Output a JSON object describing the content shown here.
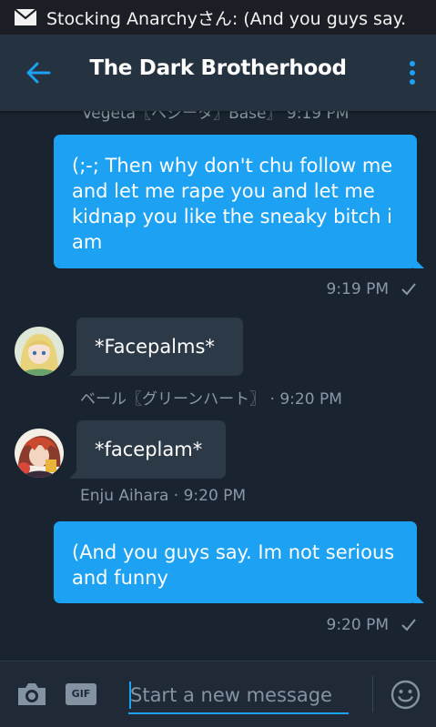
{
  "status_bar": {
    "notification_text": "Stocking Anarchyさん: (And you guys say.",
    "icon": "mail-icon"
  },
  "header": {
    "title": "The Dark Brotherhood",
    "back_icon": "back-arrow-icon",
    "menu_icon": "overflow-menu-icon"
  },
  "chat": {
    "cut_off_meta": "Vegeta〖ベジータ〗Base〗 9:19 PM",
    "messages": [
      {
        "direction": "outgoing",
        "text": "(;-; Then why don't chu follow me and let me rape you and let me kidnap you like the sneaky bitch i am",
        "meta": "9:19 PM"
      },
      {
        "direction": "incoming",
        "text": "*Facepalms*",
        "meta": "ベール〖グリーンハート〗 · 9:20 PM"
      },
      {
        "direction": "incoming",
        "text": "*faceplam*",
        "meta": "Enju Aihara · 9:20 PM"
      },
      {
        "direction": "outgoing",
        "text": "(And you guys say. Im not serious and funny",
        "meta": "9:20 PM"
      }
    ]
  },
  "composer": {
    "placeholder": "Start a new message",
    "gif_label": "GIF"
  },
  "colors": {
    "accent": "#1da1f2",
    "background": "#1a2430",
    "header": "#253341",
    "incoming_bubble": "#2c3a48"
  }
}
